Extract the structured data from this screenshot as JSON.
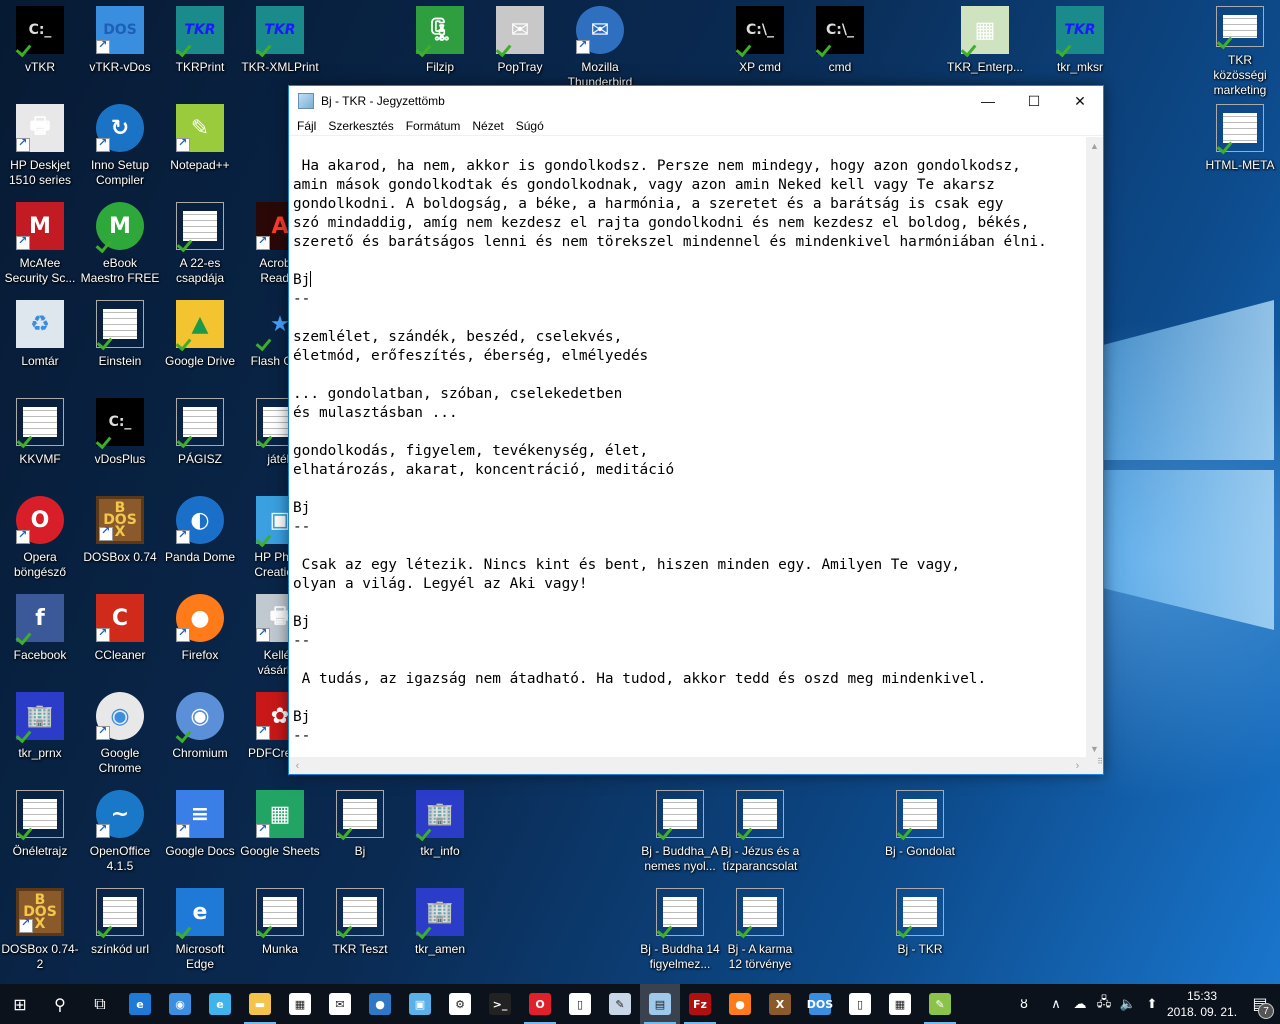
{
  "desktop": {
    "icons": [
      {
        "label": "vTKR",
        "icon": "cmd-icon",
        "badge": "check"
      },
      {
        "label": "vTKR-vDos",
        "icon": "dos-icon",
        "badge": "shortcut"
      },
      {
        "label": "TKRPrint",
        "icon": "tkr-icon",
        "badge": "check"
      },
      {
        "label": "TKR-XMLPrint",
        "icon": "tkr-icon",
        "badge": "check"
      },
      {
        "label": "Filzip",
        "icon": "filzip-icon",
        "badge": "check"
      },
      {
        "label": "PopTray",
        "icon": "poptray-icon",
        "badge": "check"
      },
      {
        "label": "Mozilla Thunderbird",
        "icon": "thunderbird-icon",
        "badge": "shortcut"
      },
      {
        "label": "XP cmd",
        "icon": "cmd-window-icon",
        "badge": "check"
      },
      {
        "label": "cmd",
        "icon": "cmd-window-icon",
        "badge": "check"
      },
      {
        "label": "TKR_Enterp...",
        "icon": "screenshot-icon",
        "badge": "check"
      },
      {
        "label": "tkr_mksr",
        "icon": "tkr-icon",
        "badge": "check"
      },
      {
        "label": "TKR közösségi marketing",
        "icon": "document-icon",
        "badge": "check"
      },
      {
        "label": "HP Deskjet 1510 series",
        "icon": "printer-icon",
        "badge": "shortcut"
      },
      {
        "label": "Inno Setup Compiler",
        "icon": "inno-setup-icon",
        "badge": "shortcut"
      },
      {
        "label": "Notepad++",
        "icon": "notepadpp-icon",
        "badge": "shortcut"
      },
      {
        "label": "HTML-META",
        "icon": "document-icon",
        "badge": "check"
      },
      {
        "label": "McAfee Security Sc...",
        "icon": "mcafee-icon",
        "badge": "shortcut"
      },
      {
        "label": "eBook Maestro FREE",
        "icon": "ebook-maestro-icon",
        "badge": "check"
      },
      {
        "label": "A 22-es csapdája",
        "icon": "document-icon",
        "badge": "check"
      },
      {
        "label": "Acrobat Reader",
        "icon": "acrobat-icon",
        "badge": "shortcut"
      },
      {
        "label": "Lomtár",
        "icon": "recycle-bin-icon",
        "badge": "none"
      },
      {
        "label": "Einstein",
        "icon": "document-icon",
        "badge": "check"
      },
      {
        "label": "Google Drive",
        "icon": "google-drive-icon",
        "badge": "check"
      },
      {
        "label": "Flash Ga...",
        "icon": "flash-star-icon",
        "badge": "check"
      },
      {
        "label": "KKVMF",
        "icon": "document-icon",
        "badge": "check"
      },
      {
        "label": "vDosPlus",
        "icon": "cmd-icon",
        "badge": "check"
      },
      {
        "label": "PÁGISZ",
        "icon": "document-icon",
        "badge": "check"
      },
      {
        "label": "játék",
        "icon": "document-icon",
        "badge": "check"
      },
      {
        "label": "Opera böngésző",
        "icon": "opera-icon",
        "badge": "shortcut"
      },
      {
        "label": "DOSBox 0.74",
        "icon": "dosbox-icon",
        "badge": "shortcut"
      },
      {
        "label": "Panda Dome",
        "icon": "panda-dome-icon",
        "badge": "shortcut"
      },
      {
        "label": "HP Photo Creations",
        "icon": "hp-photo-icon",
        "badge": "check"
      },
      {
        "label": "Facebook",
        "icon": "facebook-icon",
        "badge": "check"
      },
      {
        "label": "CCleaner",
        "icon": "ccleaner-icon",
        "badge": "shortcut"
      },
      {
        "label": "Firefox",
        "icon": "firefox-icon",
        "badge": "shortcut"
      },
      {
        "label": "Kellék vásárlás",
        "icon": "printer-supplies-icon",
        "badge": "shortcut"
      },
      {
        "label": "tkr_prnx",
        "icon": "building-icon",
        "badge": "check"
      },
      {
        "label": "Google Chrome",
        "icon": "chrome-icon",
        "badge": "shortcut"
      },
      {
        "label": "Chromium",
        "icon": "chromium-icon",
        "badge": "check"
      },
      {
        "label": "PDFCreator",
        "icon": "pdfcreator-icon",
        "badge": "shortcut"
      },
      {
        "label": "Önéletrajz",
        "icon": "document-icon",
        "badge": "check"
      },
      {
        "label": "OpenOffice 4.1.5",
        "icon": "openoffice-icon",
        "badge": "shortcut"
      },
      {
        "label": "Google Docs",
        "icon": "google-docs-icon",
        "badge": "shortcut"
      },
      {
        "label": "Google Sheets",
        "icon": "google-sheets-icon",
        "badge": "shortcut"
      },
      {
        "label": "Bj",
        "icon": "document-icon",
        "badge": "check"
      },
      {
        "label": "tkr_info",
        "icon": "building-icon",
        "badge": "check"
      },
      {
        "label": "Bj - Buddha_A nemes nyol...",
        "icon": "document-icon",
        "badge": "check"
      },
      {
        "label": "Bj - Jézus és a tízparancsolat",
        "icon": "document-icon",
        "badge": "check"
      },
      {
        "label": "Bj - Gondolat",
        "icon": "document-icon",
        "badge": "check"
      },
      {
        "label": "DOSBox 0.74-2",
        "icon": "dosbox-icon",
        "badge": "shortcut"
      },
      {
        "label": "színkód url",
        "icon": "document-icon",
        "badge": "check"
      },
      {
        "label": "Microsoft Edge",
        "icon": "edge-icon",
        "badge": "check"
      },
      {
        "label": "Munka",
        "icon": "document-icon",
        "badge": "check"
      },
      {
        "label": "TKR Teszt",
        "icon": "document-icon",
        "badge": "check"
      },
      {
        "label": "tkr_amen",
        "icon": "building-icon",
        "badge": "check"
      },
      {
        "label": "Bj - Buddha 14 figyelmez...",
        "icon": "document-icon",
        "badge": "check"
      },
      {
        "label": "Bj - A karma 12 törvénye",
        "icon": "document-icon",
        "badge": "check"
      },
      {
        "label": "Bj - TKR",
        "icon": "document-icon",
        "badge": "check"
      }
    ]
  },
  "notepad": {
    "title": "Bj - TKR - Jegyzettömb",
    "controls": {
      "minimize": "—",
      "maximize": "☐",
      "close": "✕"
    },
    "menu": [
      "Fájl",
      "Szerkesztés",
      "Formátum",
      "Nézet",
      "Súgó"
    ],
    "lines": [
      " Ha akarod, ha nem, akkor is gondolkodsz. Persze nem mindegy, hogy azon gondolkodsz,",
      "amin mások gondolkodtak és gondolkodnak, vagy azon amin Neked kell vagy Te akarsz",
      "gondolkodni. A boldogság, a béke, a harmónia, a szeretet és a barátság is csak egy",
      "szó mindaddig, amíg nem kezdesz el rajta gondolkodni és nem kezdesz el boldog, békés,",
      "szerető és barátságos lenni és nem törekszel mindennel és mindenkivel harmóniában élni.",
      "",
      "Bj",
      "--",
      "",
      "szemlélet, szándék, beszéd, cselekvés,",
      "életmód, erőfeszítés, éberség, elmélyedés",
      "",
      "... gondolatban, szóban, cselekedetben",
      "és mulasztásban ...",
      "",
      "gondolkodás, figyelem, tevékenység, élet,",
      "elhatározás, akarat, koncentráció, meditáció",
      "",
      "Bj",
      "--",
      "",
      " Csak az egy létezik. Nincs kint és bent, hiszen minden egy. Amilyen Te vagy,",
      "olyan a világ. Legyél az Aki vagy!",
      "",
      "Bj",
      "--",
      "",
      " A tudás, az igazság nem átadható. Ha tudod, akkor tedd és oszd meg mindenkivel.",
      "",
      "Bj",
      "--"
    ],
    "caret_line": 6
  },
  "taskbar": {
    "start": "start-icon",
    "search": "search-icon",
    "task_view": "task-view-icon",
    "apps": [
      {
        "name": "edge",
        "glyph": "e",
        "color": "#1e7ad6",
        "running": false
      },
      {
        "name": "chrome",
        "glyph": "◉",
        "color": "#3b8ee0",
        "running": false
      },
      {
        "name": "internet-explorer",
        "glyph": "e",
        "color": "#3fb3ec",
        "running": false
      },
      {
        "name": "file-explorer",
        "glyph": "▬",
        "color": "#f4c44a",
        "running": true
      },
      {
        "name": "store",
        "glyph": "▦",
        "color": "#ffffff",
        "running": false
      },
      {
        "name": "mail",
        "glyph": "✉",
        "color": "#ffffff",
        "running": false
      },
      {
        "name": "thunderbird",
        "glyph": "●",
        "color": "#2f78c4",
        "running": false
      },
      {
        "name": "control-panel",
        "glyph": "▣",
        "color": "#5ab0e8",
        "running": false
      },
      {
        "name": "settings",
        "glyph": "⚙",
        "color": "#ffffff",
        "running": false
      },
      {
        "name": "cmd",
        "glyph": ">_",
        "color": "#222222",
        "running": false
      },
      {
        "name": "opera",
        "glyph": "O",
        "color": "#e0202a",
        "running": true
      },
      {
        "name": "notepad-blank",
        "glyph": "▯",
        "color": "#ffffff",
        "running": false
      },
      {
        "name": "paint",
        "glyph": "✎",
        "color": "#c8d6e8",
        "running": false
      },
      {
        "name": "notepad",
        "glyph": "▤",
        "color": "#9fc9ea",
        "running": true,
        "active": true
      },
      {
        "name": "filezilla",
        "glyph": "Fz",
        "color": "#b01010",
        "running": true
      },
      {
        "name": "firefox",
        "glyph": "●",
        "color": "#ff7a18",
        "running": false
      },
      {
        "name": "dosbox",
        "glyph": "X",
        "color": "#8b5a2b",
        "running": false
      },
      {
        "name": "vdos",
        "glyph": "DOS",
        "color": "#3a8ee0",
        "running": false
      },
      {
        "name": "blank-document",
        "glyph": "▯",
        "color": "#ffffff",
        "running": false
      },
      {
        "name": "calculator",
        "glyph": "▦",
        "color": "#ffffff",
        "running": false
      },
      {
        "name": "notepadpp",
        "glyph": "✎",
        "color": "#8bc34a",
        "running": true
      }
    ],
    "tray": {
      "people": "ȣ",
      "chevron": "∧",
      "onedrive": "☁",
      "network": "🖧",
      "volume": "🔈",
      "upload": "⬆",
      "time": "15:33",
      "date": "2018. 09. 21.",
      "notification_count": "7"
    }
  }
}
